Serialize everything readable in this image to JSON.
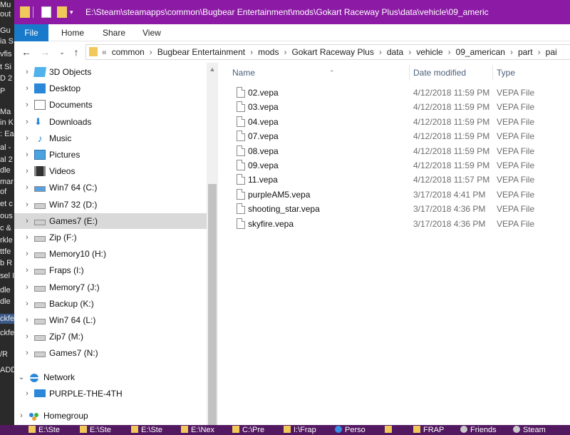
{
  "background_window": {
    "lines": [
      "Mu",
      "out",
      "Gu",
      "ia S",
      "vfis",
      "t Si",
      "D 2",
      "P",
      "Ma",
      "in K",
      ": Ea",
      "al -",
      "al 2",
      "dle",
      "mar",
      "of",
      "et c",
      "ous",
      "c &",
      "rkle",
      "ttfe",
      "b R",
      "sel I",
      "dle",
      "dle",
      "ckfe",
      "ckfe",
      "/R",
      "ADD"
    ]
  },
  "titlebar": {
    "path": "E:\\Steam\\steamapps\\common\\Bugbear Entertainment\\mods\\Gokart Raceway Plus\\data\\vehicle\\09_americ"
  },
  "ribbon": {
    "tabs": [
      "File",
      "Home",
      "Share",
      "View"
    ]
  },
  "address": {
    "overflow": "«",
    "crumbs": [
      "common",
      "Bugbear Entertainment",
      "mods",
      "Gokart Raceway Plus",
      "data",
      "vehicle",
      "09_american",
      "part",
      "pai"
    ]
  },
  "navigation": {
    "items": [
      {
        "label": "3D Objects",
        "icon": "3d-objects-icon"
      },
      {
        "label": "Desktop",
        "icon": "desktop-icon"
      },
      {
        "label": "Documents",
        "icon": "documents-icon"
      },
      {
        "label": "Downloads",
        "icon": "downloads-icon"
      },
      {
        "label": "Music",
        "icon": "music-icon"
      },
      {
        "label": "Pictures",
        "icon": "pictures-icon"
      },
      {
        "label": "Videos",
        "icon": "videos-icon"
      },
      {
        "label": "Win7 64 (C:)",
        "icon": "windows-drive-icon"
      },
      {
        "label": "Win7 32 (D:)",
        "icon": "drive-icon"
      },
      {
        "label": "Games7 (E:)",
        "icon": "drive-icon",
        "selected": true
      },
      {
        "label": "Zip (F:)",
        "icon": "drive-icon"
      },
      {
        "label": "Memory10 (H:)",
        "icon": "drive-icon"
      },
      {
        "label": "Fraps (I:)",
        "icon": "drive-icon"
      },
      {
        "label": "Memory7 (J:)",
        "icon": "drive-icon"
      },
      {
        "label": "Backup (K:)",
        "icon": "drive-icon"
      },
      {
        "label": "Win7 64 (L:)",
        "icon": "drive-icon"
      },
      {
        "label": "Zip7 (M:)",
        "icon": "drive-icon"
      },
      {
        "label": "Games7 (N:)",
        "icon": "drive-icon"
      }
    ],
    "network_label": "Network",
    "network_child": "PURPLE-THE-4TH",
    "homegroup_label": "Homegroup"
  },
  "columns": {
    "name": "Name",
    "date": "Date modified",
    "type": "Type"
  },
  "files": [
    {
      "name": "02.vepa",
      "date": "4/12/2018 11:59 PM",
      "type": "VEPA File"
    },
    {
      "name": "03.vepa",
      "date": "4/12/2018 11:59 PM",
      "type": "VEPA File"
    },
    {
      "name": "04.vepa",
      "date": "4/12/2018 11:59 PM",
      "type": "VEPA File"
    },
    {
      "name": "07.vepa",
      "date": "4/12/2018 11:59 PM",
      "type": "VEPA File"
    },
    {
      "name": "08.vepa",
      "date": "4/12/2018 11:59 PM",
      "type": "VEPA File"
    },
    {
      "name": "09.vepa",
      "date": "4/12/2018 11:59 PM",
      "type": "VEPA File"
    },
    {
      "name": "11.vepa",
      "date": "4/12/2018 11:57 PM",
      "type": "VEPA File"
    },
    {
      "name": "purpleAM5.vepa",
      "date": "3/17/2018 4:41 PM",
      "type": "VEPA File"
    },
    {
      "name": "shooting_star.vepa",
      "date": "3/17/2018 4:36 PM",
      "type": "VEPA File"
    },
    {
      "name": "skyfire.vepa",
      "date": "3/17/2018 4:36 PM",
      "type": "VEPA File"
    }
  ],
  "taskbar": {
    "items": [
      {
        "label": "E:\\Ste",
        "icon": "folder-icon"
      },
      {
        "label": "E:\\Ste",
        "icon": "folder-icon"
      },
      {
        "label": "E:\\Ste",
        "icon": "folder-icon"
      },
      {
        "label": "E:\\Nex",
        "icon": "folder-icon"
      },
      {
        "label": "C:\\Pre",
        "icon": "folder-icon"
      },
      {
        "label": "I:\\Frap",
        "icon": "folder-icon"
      },
      {
        "label": "Perso",
        "icon": "browser-icon"
      },
      {
        "label": "",
        "icon": "folder-icon"
      },
      {
        "label": "FRAP",
        "icon": "folder-icon"
      },
      {
        "label": "Friends",
        "icon": "steam-icon"
      },
      {
        "label": "Steam",
        "icon": "steam-icon"
      }
    ]
  },
  "colors": {
    "titlebar": "#8c1aa5",
    "file_tab": "#1979ca",
    "selection": "#d9d9d9",
    "taskbar": "#521860"
  }
}
